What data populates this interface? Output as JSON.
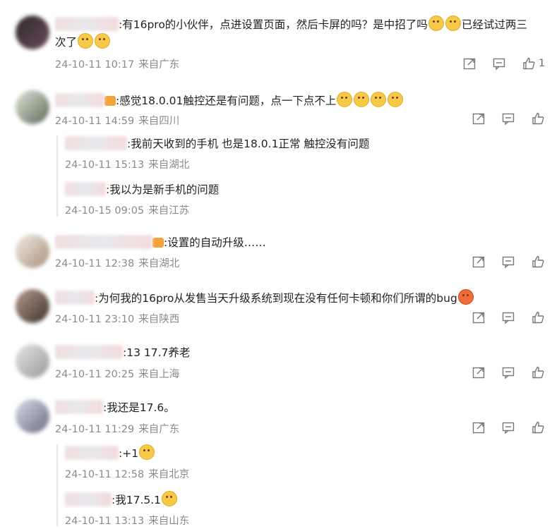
{
  "comments": [
    {
      "text": ":有16pro的小伙伴，点进设置页面，然后卡屏的吗？是中招了吗",
      "text_tail": "已经试过两三",
      "text_line2": "次了",
      "date": "24-10-11 10:17",
      "location": "来自广东",
      "like_count": "1"
    },
    {
      "text": ":感觉18.0.01触控还是有问题，点一下点不上",
      "date": "24-10-11 14:59",
      "location": "来自四川",
      "replies": [
        {
          "text": ":我前天收到的手机 也是18.0.1正常 触控没有问题",
          "date": "24-10-11 15:13",
          "location": "来自湖北"
        },
        {
          "text": ":我以为是新手机的问题",
          "date": "24-10-15 09:05",
          "location": "来自江苏"
        }
      ]
    },
    {
      "text": ":设置的自动升级……",
      "date": "24-10-11 12:38",
      "location": "来自湖北"
    },
    {
      "text": ":为何我的16pro从发售当天升级系统到现在没有任何卡顿和你们所谓的bug",
      "date": "24-10-11 23:10",
      "location": "来自陕西"
    },
    {
      "text": ":13 17.7养老",
      "date": "24-10-11 20:25",
      "location": "来自上海"
    },
    {
      "text": ":我还是17.6。",
      "date": "24-10-11 11:29",
      "location": "来自广东",
      "replies": [
        {
          "text": ":+1",
          "date": "24-10-11 12:58",
          "location": "来自北京"
        },
        {
          "text": ":我17.5.1",
          "date": "24-10-11 13:13",
          "location": "来自山东"
        }
      ]
    }
  ],
  "icons": {
    "share": "share-icon",
    "comment": "comment-icon",
    "like": "thumbs-up-icon"
  },
  "colors": {
    "meta": "#8a8a8a",
    "text": "#222222",
    "emoji": "#f7c948"
  }
}
